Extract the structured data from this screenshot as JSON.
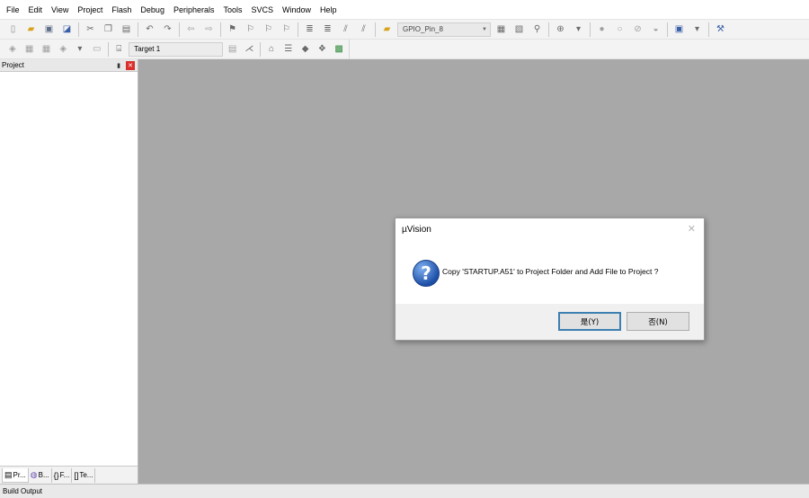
{
  "menu": [
    "File",
    "Edit",
    "View",
    "Project",
    "Flash",
    "Debug",
    "Peripherals",
    "Tools",
    "SVCS",
    "Window",
    "Help"
  ],
  "toolbar1": {
    "function_combo": "GPIO_Pin_8"
  },
  "toolbar2": {
    "target_combo": "Target 1"
  },
  "project_panel": {
    "title": "Project",
    "tabs": [
      "Pr...",
      "B...",
      "F...",
      "Te..."
    ]
  },
  "build_output": {
    "label": "Build Output"
  },
  "dialog": {
    "title": "µVision",
    "message": "Copy 'STARTUP.A51' to Project Folder and Add File to Project ?",
    "yes_label": "是(Y)",
    "no_label": "否(N)"
  },
  "colors": {
    "workspace": "#a8a8a8",
    "close_red": "#d9302c",
    "question_blue": "#1d4fa8"
  }
}
